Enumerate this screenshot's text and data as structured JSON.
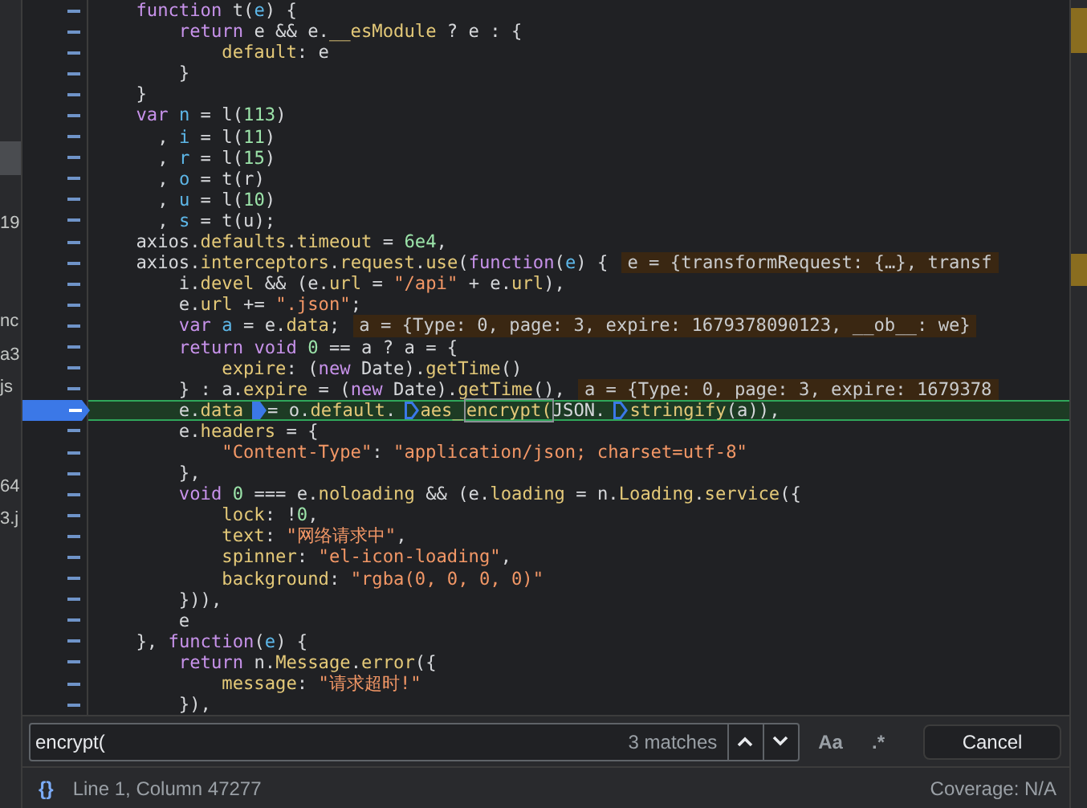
{
  "file_tree": [
    {
      "selected": false
    },
    {
      "selected": false
    },
    {
      "selected": false
    },
    {
      "selected": false
    },
    {
      "selected": true
    },
    {
      "selected": false
    },
    {
      "label": "19",
      "selected": false
    },
    {
      "selected": false
    },
    {
      "selected": false
    },
    {
      "label": "nc",
      "selected": false
    },
    {
      "label": "a3",
      "selected": false
    },
    {
      "label": "js",
      "selected": false
    },
    {
      "selected": false
    },
    {
      "selected": false
    },
    {
      "label": "64",
      "selected": false
    },
    {
      "label": "3.j",
      "selected": false
    }
  ],
  "lines": [
    {
      "breakpoint": false,
      "current": false,
      "tokens": [
        {
          "kind": "keyword",
          "text": "    function"
        },
        {
          "kind": "plain",
          "text": " t("
        },
        {
          "kind": "variable",
          "text": "e"
        },
        {
          "kind": "plain",
          "text": ") {"
        }
      ]
    },
    {
      "breakpoint": false,
      "current": false,
      "tokens": [
        {
          "kind": "keyword",
          "text": "        return"
        },
        {
          "kind": "plain",
          "text": " e && e."
        },
        {
          "kind": "property",
          "text": "__esModule"
        },
        {
          "kind": "plain",
          "text": " ? e : {"
        }
      ]
    },
    {
      "breakpoint": false,
      "current": false,
      "tokens": [
        {
          "kind": "property",
          "text": "            default"
        },
        {
          "kind": "plain",
          "text": ": e"
        }
      ]
    },
    {
      "breakpoint": false,
      "current": false,
      "tokens": [
        {
          "kind": "plain",
          "text": "        }"
        }
      ]
    },
    {
      "breakpoint": false,
      "current": false,
      "tokens": [
        {
          "kind": "plain",
          "text": "    }"
        }
      ]
    },
    {
      "breakpoint": false,
      "current": false,
      "tokens": [
        {
          "kind": "keyword",
          "text": "    var"
        },
        {
          "kind": "variable",
          "text": " n"
        },
        {
          "kind": "plain",
          "text": " = l("
        },
        {
          "kind": "number",
          "text": "113"
        },
        {
          "kind": "plain",
          "text": ")"
        }
      ]
    },
    {
      "breakpoint": false,
      "current": false,
      "tokens": [
        {
          "kind": "plain",
          "text": "      , "
        },
        {
          "kind": "variable",
          "text": "i"
        },
        {
          "kind": "plain",
          "text": " = l("
        },
        {
          "kind": "number",
          "text": "11"
        },
        {
          "kind": "plain",
          "text": ")"
        }
      ]
    },
    {
      "breakpoint": false,
      "current": false,
      "tokens": [
        {
          "kind": "plain",
          "text": "      , "
        },
        {
          "kind": "variable",
          "text": "r"
        },
        {
          "kind": "plain",
          "text": " = l("
        },
        {
          "kind": "number",
          "text": "15"
        },
        {
          "kind": "plain",
          "text": ")"
        }
      ]
    },
    {
      "breakpoint": false,
      "current": false,
      "tokens": [
        {
          "kind": "plain",
          "text": "      , "
        },
        {
          "kind": "variable",
          "text": "o"
        },
        {
          "kind": "plain",
          "text": " = t(r)"
        }
      ]
    },
    {
      "breakpoint": false,
      "current": false,
      "tokens": [
        {
          "kind": "plain",
          "text": "      , "
        },
        {
          "kind": "variable",
          "text": "u"
        },
        {
          "kind": "plain",
          "text": " = l("
        },
        {
          "kind": "number",
          "text": "10"
        },
        {
          "kind": "plain",
          "text": ")"
        }
      ]
    },
    {
      "breakpoint": false,
      "current": false,
      "tokens": [
        {
          "kind": "plain",
          "text": "      , "
        },
        {
          "kind": "variable",
          "text": "s"
        },
        {
          "kind": "plain",
          "text": " = t(u);"
        }
      ]
    },
    {
      "breakpoint": false,
      "current": false,
      "tokens": [
        {
          "kind": "plain",
          "text": "    axios."
        },
        {
          "kind": "property",
          "text": "defaults"
        },
        {
          "kind": "plain",
          "text": "."
        },
        {
          "kind": "property",
          "text": "timeout"
        },
        {
          "kind": "plain",
          "text": " = "
        },
        {
          "kind": "number",
          "text": "6e4"
        },
        {
          "kind": "plain",
          "text": ","
        }
      ]
    },
    {
      "breakpoint": false,
      "current": false,
      "preview": "e = {transformRequest: {…}, transf",
      "tokens": [
        {
          "kind": "plain",
          "text": "    axios."
        },
        {
          "kind": "property",
          "text": "interceptors"
        },
        {
          "kind": "plain",
          "text": "."
        },
        {
          "kind": "property",
          "text": "request"
        },
        {
          "kind": "plain",
          "text": "."
        },
        {
          "kind": "property",
          "text": "use"
        },
        {
          "kind": "plain",
          "text": "("
        },
        {
          "kind": "keyword",
          "text": "function"
        },
        {
          "kind": "plain",
          "text": "("
        },
        {
          "kind": "variable",
          "text": "e"
        },
        {
          "kind": "plain",
          "text": ") {"
        }
      ]
    },
    {
      "breakpoint": false,
      "current": false,
      "tokens": [
        {
          "kind": "plain",
          "text": "        i."
        },
        {
          "kind": "property",
          "text": "devel"
        },
        {
          "kind": "plain",
          "text": " && (e."
        },
        {
          "kind": "property",
          "text": "url"
        },
        {
          "kind": "plain",
          "text": " = "
        },
        {
          "kind": "string",
          "text": "\"/api\""
        },
        {
          "kind": "plain",
          "text": " + e."
        },
        {
          "kind": "property",
          "text": "url"
        },
        {
          "kind": "plain",
          "text": "),"
        }
      ]
    },
    {
      "breakpoint": false,
      "current": false,
      "tokens": [
        {
          "kind": "plain",
          "text": "        e."
        },
        {
          "kind": "property",
          "text": "url"
        },
        {
          "kind": "plain",
          "text": " += "
        },
        {
          "kind": "string",
          "text": "\".json\""
        },
        {
          "kind": "plain",
          "text": ";"
        }
      ]
    },
    {
      "breakpoint": false,
      "current": false,
      "preview": "a = {Type: 0, page: 3, expire: 1679378090123, __ob__: we}",
      "tokens": [
        {
          "kind": "keyword",
          "text": "        var"
        },
        {
          "kind": "variable",
          "text": " a"
        },
        {
          "kind": "plain",
          "text": " = e."
        },
        {
          "kind": "property",
          "text": "data"
        },
        {
          "kind": "plain",
          "text": ";"
        }
      ]
    },
    {
      "breakpoint": false,
      "current": false,
      "tokens": [
        {
          "kind": "keyword",
          "text": "        return"
        },
        {
          "kind": "keyword",
          "text": " void"
        },
        {
          "kind": "number",
          "text": " 0"
        },
        {
          "kind": "plain",
          "text": " == a ? a = {"
        }
      ]
    },
    {
      "breakpoint": false,
      "current": false,
      "tokens": [
        {
          "kind": "property",
          "text": "            expire"
        },
        {
          "kind": "plain",
          "text": ": ("
        },
        {
          "kind": "keyword",
          "text": "new"
        },
        {
          "kind": "plain",
          "text": " Date)."
        },
        {
          "kind": "property",
          "text": "getTime"
        },
        {
          "kind": "plain",
          "text": "()"
        }
      ]
    },
    {
      "breakpoint": false,
      "current": false,
      "preview": "a = {Type: 0, page: 3, expire: 1679378",
      "tokens": [
        {
          "kind": "plain",
          "text": "        } : a."
        },
        {
          "kind": "property",
          "text": "expire"
        },
        {
          "kind": "plain",
          "text": " = ("
        },
        {
          "kind": "keyword",
          "text": "new"
        },
        {
          "kind": "plain",
          "text": " Date)."
        },
        {
          "kind": "property",
          "text": "getTime"
        },
        {
          "kind": "plain",
          "text": "(),"
        }
      ]
    },
    {
      "breakpoint": true,
      "current": true,
      "tokens": [
        {
          "kind": "plain",
          "text": "        e."
        },
        {
          "kind": "property",
          "text": "data"
        },
        {
          "kind": "mark",
          "active": true
        },
        {
          "kind": "plain",
          "text": "= o."
        },
        {
          "kind": "property",
          "text": "default"
        },
        {
          "kind": "plain",
          "text": "."
        },
        {
          "kind": "mark",
          "active": false
        },
        {
          "kind": "property",
          "text": "aes_"
        },
        {
          "kind": "match",
          "text": "encrypt("
        },
        {
          "kind": "plain",
          "text": "JSON."
        },
        {
          "kind": "mark",
          "active": false
        },
        {
          "kind": "property",
          "text": "stringify"
        },
        {
          "kind": "plain",
          "text": "(a)),"
        }
      ]
    },
    {
      "breakpoint": false,
      "current": false,
      "tokens": [
        {
          "kind": "plain",
          "text": "        e."
        },
        {
          "kind": "property",
          "text": "headers"
        },
        {
          "kind": "plain",
          "text": " = {"
        }
      ]
    },
    {
      "breakpoint": false,
      "current": false,
      "tokens": [
        {
          "kind": "string",
          "text": "            \"Content-Type\""
        },
        {
          "kind": "plain",
          "text": ": "
        },
        {
          "kind": "string",
          "text": "\"application/json; charset=utf-8\""
        }
      ]
    },
    {
      "breakpoint": false,
      "current": false,
      "tokens": [
        {
          "kind": "plain",
          "text": "        },"
        }
      ]
    },
    {
      "breakpoint": false,
      "current": false,
      "tokens": [
        {
          "kind": "keyword",
          "text": "        void"
        },
        {
          "kind": "number",
          "text": " 0"
        },
        {
          "kind": "plain",
          "text": " === e."
        },
        {
          "kind": "property",
          "text": "noloading"
        },
        {
          "kind": "plain",
          "text": " && (e."
        },
        {
          "kind": "property",
          "text": "loading"
        },
        {
          "kind": "plain",
          "text": " = n."
        },
        {
          "kind": "property",
          "text": "Loading"
        },
        {
          "kind": "plain",
          "text": "."
        },
        {
          "kind": "property",
          "text": "service"
        },
        {
          "kind": "plain",
          "text": "({"
        }
      ]
    },
    {
      "breakpoint": false,
      "current": false,
      "tokens": [
        {
          "kind": "property",
          "text": "            lock"
        },
        {
          "kind": "plain",
          "text": ": !"
        },
        {
          "kind": "number",
          "text": "0"
        },
        {
          "kind": "plain",
          "text": ","
        }
      ]
    },
    {
      "breakpoint": false,
      "current": false,
      "tokens": [
        {
          "kind": "property",
          "text": "            text"
        },
        {
          "kind": "plain",
          "text": ": "
        },
        {
          "kind": "string",
          "text": "\"网络请求中\""
        },
        {
          "kind": "plain",
          "text": ","
        }
      ]
    },
    {
      "breakpoint": false,
      "current": false,
      "tokens": [
        {
          "kind": "property",
          "text": "            spinner"
        },
        {
          "kind": "plain",
          "text": ": "
        },
        {
          "kind": "string",
          "text": "\"el-icon-loading\""
        },
        {
          "kind": "plain",
          "text": ","
        }
      ]
    },
    {
      "breakpoint": false,
      "current": false,
      "tokens": [
        {
          "kind": "property",
          "text": "            background"
        },
        {
          "kind": "plain",
          "text": ": "
        },
        {
          "kind": "string",
          "text": "\"rgba(0, 0, 0, 0)\""
        }
      ]
    },
    {
      "breakpoint": false,
      "current": false,
      "tokens": [
        {
          "kind": "plain",
          "text": "        })),"
        }
      ]
    },
    {
      "breakpoint": false,
      "current": false,
      "tokens": [
        {
          "kind": "plain",
          "text": "        e"
        }
      ]
    },
    {
      "breakpoint": false,
      "current": false,
      "tokens": [
        {
          "kind": "plain",
          "text": "    }, "
        },
        {
          "kind": "keyword",
          "text": "function"
        },
        {
          "kind": "plain",
          "text": "("
        },
        {
          "kind": "variable",
          "text": "e"
        },
        {
          "kind": "plain",
          "text": ") {"
        }
      ]
    },
    {
      "breakpoint": false,
      "current": false,
      "tokens": [
        {
          "kind": "keyword",
          "text": "        return"
        },
        {
          "kind": "plain",
          "text": " n."
        },
        {
          "kind": "property",
          "text": "Message"
        },
        {
          "kind": "plain",
          "text": "."
        },
        {
          "kind": "property",
          "text": "error"
        },
        {
          "kind": "plain",
          "text": "({"
        }
      ]
    },
    {
      "breakpoint": false,
      "current": false,
      "tokens": [
        {
          "kind": "property",
          "text": "            message"
        },
        {
          "kind": "plain",
          "text": ": "
        },
        {
          "kind": "string",
          "text": "\"请求超时!\""
        }
      ]
    },
    {
      "breakpoint": false,
      "current": false,
      "tokens": [
        {
          "kind": "plain",
          "text": "        }),"
        }
      ]
    }
  ],
  "search": {
    "value": "encrypt(",
    "matches": "3 matches",
    "case_toggle": "Aa",
    "regex_toggle": ".*",
    "cancel": "Cancel"
  },
  "status_bar": {
    "format_button": "{}",
    "position": "Line 1, Column 47277",
    "coverage": "Coverage: N/A"
  }
}
